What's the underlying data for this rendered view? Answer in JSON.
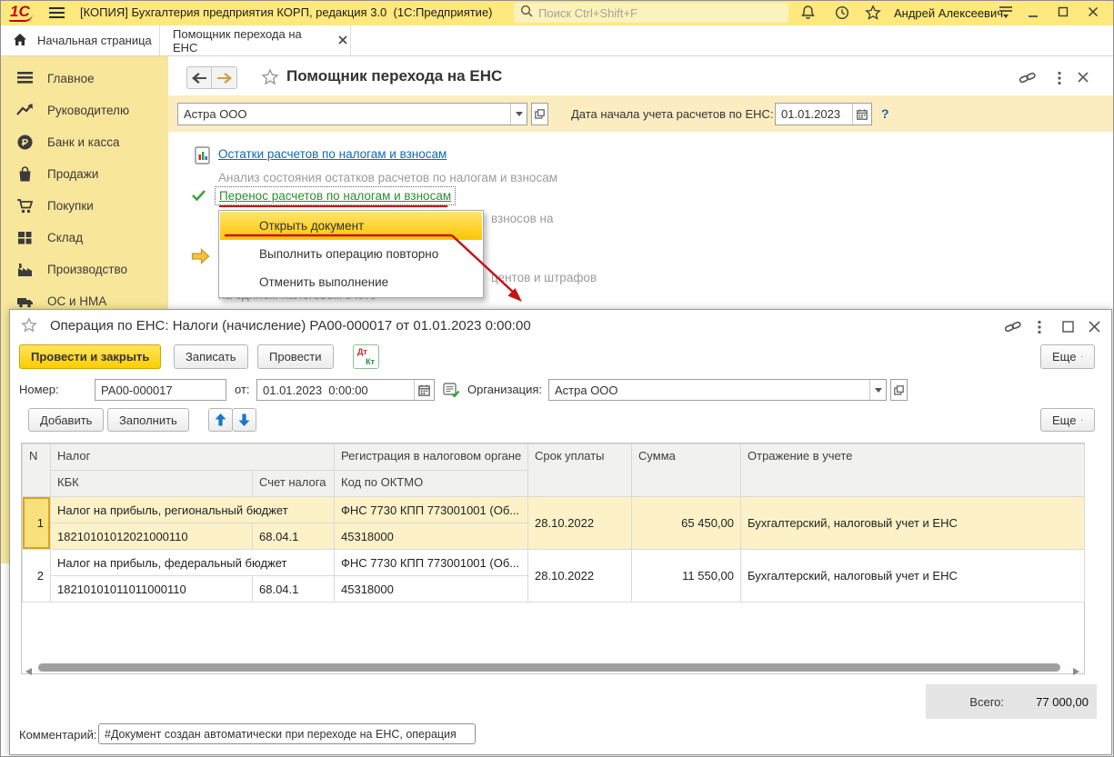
{
  "colors": {
    "titlebar_yellow": "#ffe87d",
    "sidebar_yellow": "#f8e69a",
    "params_yellow": "#fcedc0",
    "tab_green": "#22a03c",
    "selection_yellow": "#fdf1c8",
    "menu_highlight": "#fdc500",
    "primary_button_yellow": "#fcce00",
    "annotation_red": "#c41414",
    "link_blue": "#0f69ae",
    "done_link_green": "#2e8b33"
  },
  "app": {
    "logo": "1С",
    "title": "[КОПИЯ] Бухгалтерия предприятия КОРП, редакция 3.0  (1С:Предприятие)",
    "search_placeholder": "Поиск Ctrl+Shift+F",
    "user_name": "Андрей Алексеевич"
  },
  "tabs": [
    {
      "label": "Начальная страница"
    },
    {
      "label": "Помощник перехода на ЕНС"
    }
  ],
  "sidebar": {
    "items": [
      {
        "label": "Главное"
      },
      {
        "label": "Руководителю"
      },
      {
        "label": "Банк и касса"
      },
      {
        "label": "Продажи"
      },
      {
        "label": "Покупки"
      },
      {
        "label": "Склад"
      },
      {
        "label": "Производство"
      },
      {
        "label": "ОС и НМА"
      }
    ]
  },
  "assistant": {
    "title": "Помощник перехода на ЕНС",
    "org_value": "Астра ООО",
    "date_label": "Дата начала учета расчетов по ЕНС:",
    "date_value": "01.01.2023",
    "help_label": "?",
    "step1_link": "Остатки расчетов по налогам и взносам",
    "step1_desc": "Анализ состояния остатков расчетов по налогам и взносам",
    "step2_link": "Перенос расчетов по налогам и взносам",
    "partial_text_1": "взносов на",
    "partial_text_2": "центов и штрафов",
    "partial_text_3": "на едином налоговом счете"
  },
  "context_menu": {
    "items": [
      {
        "label": "Открыть документ"
      },
      {
        "label": "Выполнить операцию повторно"
      },
      {
        "label": "Отменить выполнение"
      }
    ]
  },
  "dialog": {
    "title": "Операция по ЕНС: Налоги (начисление) РА00-000017 от 01.01.2023 0:00:00",
    "buttons": {
      "post_close": "Провести и закрыть",
      "write": "Записать",
      "post": "Провести",
      "more": "Еще"
    },
    "dtkt": {
      "dt": "Дт",
      "kt": "Кт"
    },
    "fields": {
      "number_label": "Номер:",
      "number_value": "РА00-000017",
      "date_label": "от:",
      "date_value": "01.01.2023  0:00:00",
      "org_label": "Организация:",
      "org_value": "Астра ООО"
    },
    "rowtools": {
      "add": "Добавить",
      "fill": "Заполнить",
      "more": "Еще"
    },
    "table": {
      "headers": {
        "n": "N",
        "tax": "Налог",
        "kbk": "КБК",
        "account": "Счет налога",
        "registration": "Регистрация в налоговом органе",
        "oktmo": "Код по ОКТМО",
        "due": "Срок уплаты",
        "amount": "Сумма",
        "reflection": "Отражение в учете"
      },
      "rows": [
        {
          "n": "1",
          "tax": "Налог на прибыль, региональный бюджет",
          "kbk": "18210101012021000110",
          "account": "68.04.1",
          "registration": "ФНС 7730 КПП 773001001 (Об...",
          "oktmo": "45318000",
          "due": "28.10.2022",
          "amount": "65 450,00",
          "reflection": "Бухгалтерский, налоговый учет и ЕНС"
        },
        {
          "n": "2",
          "tax": "Налог на прибыль, федеральный бюджет",
          "kbk": "18210101011011000110",
          "account": "68.04.1",
          "registration": "ФНС 7730 КПП 773001001 (Об...",
          "oktmo": "45318000",
          "due": "28.10.2022",
          "amount": "11 550,00",
          "reflection": "Бухгалтерский, налоговый учет и ЕНС"
        }
      ]
    },
    "total_label": "Всего:",
    "total_value": "77 000,00",
    "comment_label": "Комментарий:",
    "comment_value": "#Документ создан автоматически при переходе на ЕНС, операция"
  }
}
